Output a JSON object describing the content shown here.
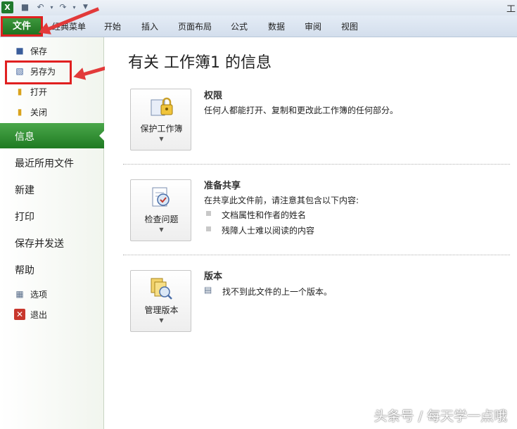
{
  "window": {
    "title": "工"
  },
  "qat": {
    "icons": [
      "excel-app-icon",
      "save-icon",
      "undo-icon",
      "redo-icon",
      "customize-icon"
    ]
  },
  "ribbon": {
    "file_tab": "文件",
    "tabs": [
      "经典菜单",
      "开始",
      "插入",
      "页面布局",
      "公式",
      "数据",
      "审阅",
      "视图"
    ]
  },
  "nav": {
    "small_top": [
      {
        "label": "保存",
        "icon": "save-icon"
      },
      {
        "label": "另存为",
        "icon": "save-as-icon"
      },
      {
        "label": "打开",
        "icon": "open-folder-icon"
      },
      {
        "label": "关闭",
        "icon": "close-folder-icon"
      }
    ],
    "big": [
      "信息",
      "最近所用文件",
      "新建",
      "打印",
      "保存并发送",
      "帮助"
    ],
    "small_bottom": [
      {
        "label": "选项",
        "icon": "options-icon"
      },
      {
        "label": "退出",
        "icon": "exit-icon"
      }
    ],
    "active": "信息"
  },
  "main": {
    "title": "有关 工作簿1 的信息",
    "permissions": {
      "button": "保护工作簿",
      "title": "权限",
      "text": "任何人都能打开、复制和更改此工作簿的任何部分。"
    },
    "prepare": {
      "button": "检查问题",
      "title": "准备共享",
      "text": "在共享此文件前，请注意其包含以下内容:",
      "bullets": [
        "文档属性和作者的姓名",
        "残障人士难以阅读的内容"
      ]
    },
    "versions": {
      "button": "管理版本",
      "title": "版本",
      "text": "找不到此文件的上一个版本。"
    }
  },
  "watermark": "头条号 / 每天学一点哦",
  "colors": {
    "accent_green": "#1f7a22",
    "highlight_red": "#e02020"
  }
}
